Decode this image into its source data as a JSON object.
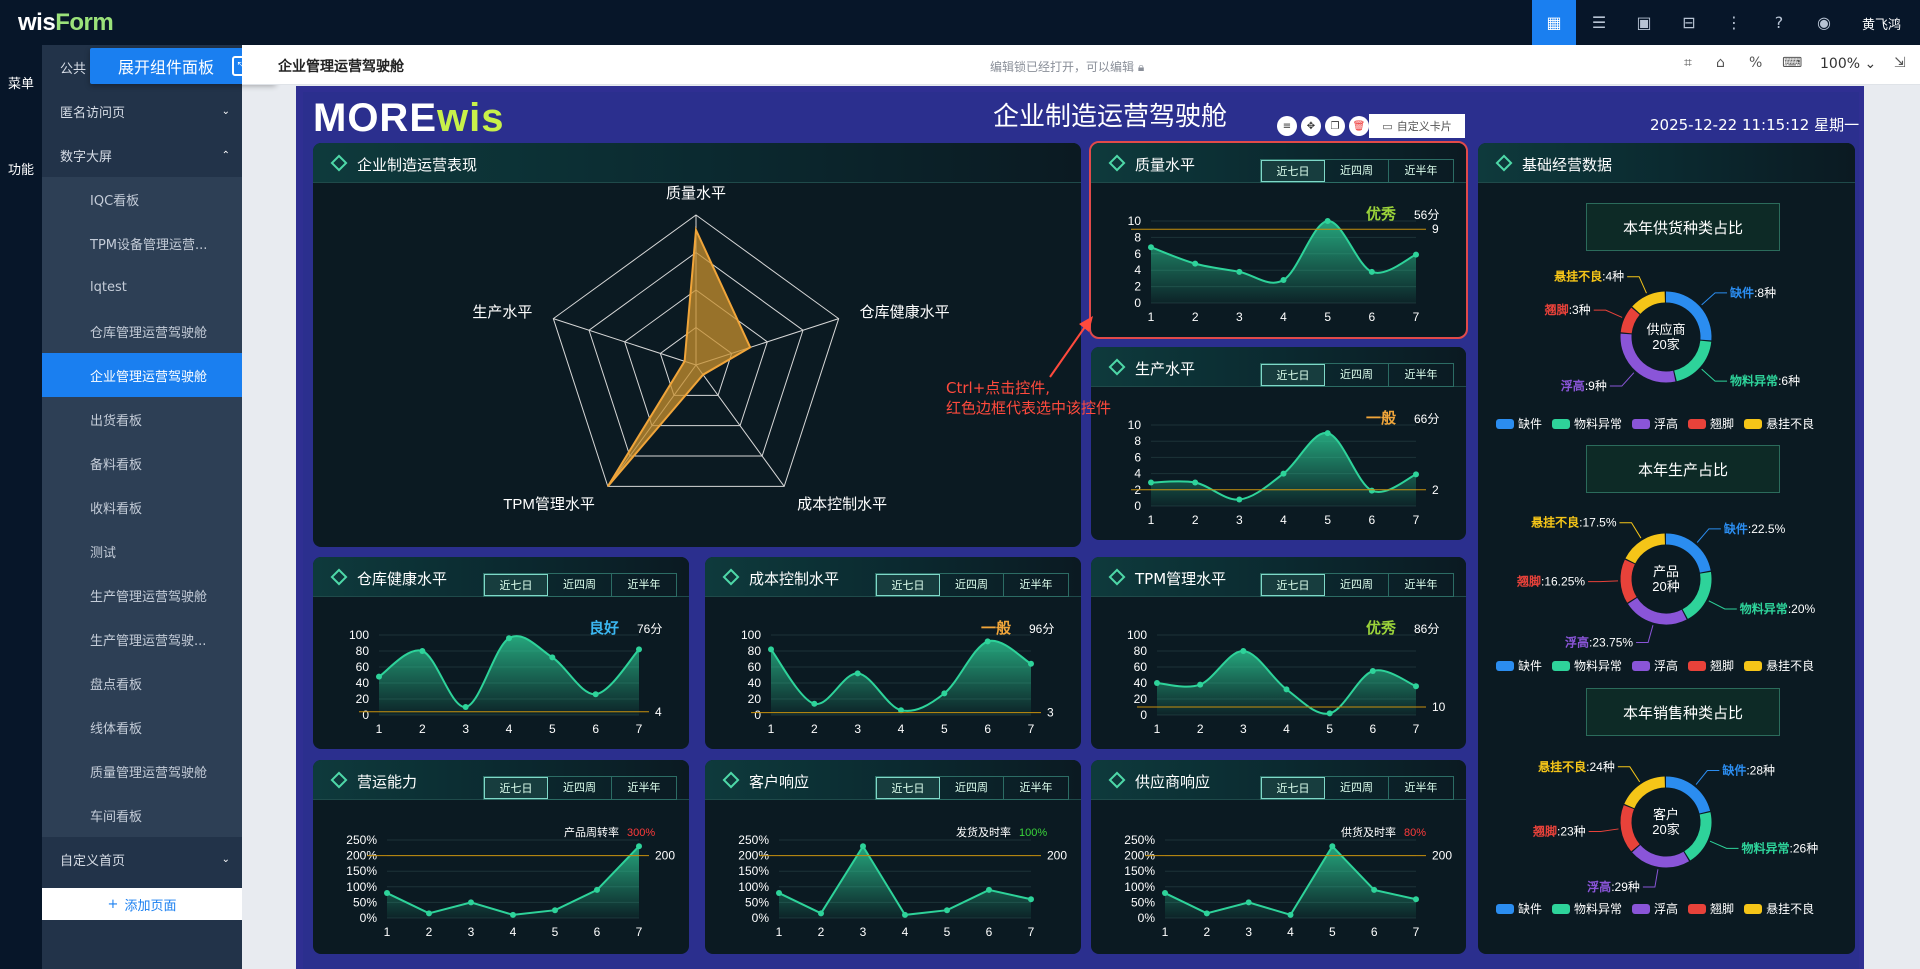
{
  "app": {
    "logo_main": "wis",
    "logo_accent": "Form",
    "username": "黄飞鸿"
  },
  "rail": {
    "menu": "菜单",
    "func": "功能"
  },
  "sidebar": {
    "public_partial": "公共",
    "items": [
      {
        "label": "匿名访问页",
        "type": "group",
        "chev": "⌄"
      },
      {
        "label": "数字大屏",
        "type": "group",
        "chev": "⌃"
      },
      {
        "label": "IQC看板",
        "type": "sub"
      },
      {
        "label": "TPM设备管理运营...",
        "type": "sub"
      },
      {
        "label": "lqtest",
        "type": "sub"
      },
      {
        "label": "仓库管理运营驾驶舱",
        "type": "sub"
      },
      {
        "label": "企业管理运营驾驶舱",
        "type": "sub",
        "active": true
      },
      {
        "label": "出货看板",
        "type": "sub"
      },
      {
        "label": "备料看板",
        "type": "sub"
      },
      {
        "label": "收料看板",
        "type": "sub"
      },
      {
        "label": "测试",
        "type": "sub"
      },
      {
        "label": "生产管理运营驾驶舱",
        "type": "sub"
      },
      {
        "label": "生产管理运营驾驶...",
        "type": "sub"
      },
      {
        "label": "盘点看板",
        "type": "sub"
      },
      {
        "label": "线体看板",
        "type": "sub"
      },
      {
        "label": "质量管理运营驾驶舱",
        "type": "sub"
      },
      {
        "label": "车间看板",
        "type": "sub"
      },
      {
        "label": "自定义首页",
        "type": "group",
        "chev": "⌄"
      }
    ],
    "add_page": "添加页面"
  },
  "expand_button": "展开组件面板",
  "subbar": {
    "page_name": "企业管理运营驾驶舱",
    "lock_note": "编辑锁已经打开，可以编辑",
    "zoom": "100%"
  },
  "dashboard": {
    "brand_a": "MORE",
    "brand_b": "wis",
    "title": "企业制造运营驾驶舱",
    "datetime": "2025-12-22 11:15:12 星期一",
    "custom_card": "自定义卡片",
    "hint": [
      "Ctrl+点击控件,",
      "红色边框代表选中该控件"
    ],
    "tabs": [
      "近七日",
      "近四周",
      "近半年"
    ],
    "panels": {
      "radar": {
        "title": "企业制造运营表现"
      },
      "quality": {
        "title": "质量水平",
        "grade": "优秀",
        "score": "56分"
      },
      "production": {
        "title": "生产水平",
        "grade": "一般",
        "score": "66分"
      },
      "warehouse": {
        "title": "仓库健康水平",
        "grade": "良好",
        "score": "76分"
      },
      "cost": {
        "title": "成本控制水平",
        "grade": "一般",
        "score": "96分"
      },
      "tpm": {
        "title": "TPM管理水平",
        "grade": "优秀",
        "score": "86分"
      },
      "ops": {
        "title": "营运能力",
        "metric": "产品周转率",
        "pct": "300%"
      },
      "customer": {
        "title": "客户响应",
        "metric": "发货及时率",
        "pct": "100%"
      },
      "supplier": {
        "title": "供应商响应",
        "metric": "供货及时率",
        "pct": "80%"
      },
      "basic": {
        "title": "基础经营数据"
      }
    },
    "donut_legend": [
      "缺件",
      "物料异常",
      "浮高",
      "翘脚",
      "悬挂不良"
    ],
    "donuts": [
      {
        "subtitle": "本年供货种类占比",
        "center": [
          "供应商",
          "20家"
        ],
        "labels": [
          {
            "name": "缺件",
            "val": ":8种"
          },
          {
            "name": "物料异常",
            "val": ":6种"
          },
          {
            "name": "浮高",
            "val": ":9种"
          },
          {
            "name": "翘脚",
            "val": ":3种"
          },
          {
            "name": "悬挂不良",
            "val": ":4种"
          }
        ]
      },
      {
        "subtitle": "本年生产占比",
        "center": [
          "产品",
          "20种"
        ],
        "labels": [
          {
            "name": "缺件",
            "val": ":22.5%"
          },
          {
            "name": "物料异常",
            "val": ":20%"
          },
          {
            "name": "浮高",
            "val": ":23.75%"
          },
          {
            "name": "翘脚",
            "val": ":16.25%"
          },
          {
            "name": "悬挂不良",
            "val": ":17.5%"
          }
        ]
      },
      {
        "subtitle": "本年销售种类占比",
        "center": [
          "客户",
          "20家"
        ],
        "labels": [
          {
            "name": "缺件",
            "val": ":28种"
          },
          {
            "name": "物料异常",
            "val": ":26种"
          },
          {
            "name": "浮高",
            "val": ":29种"
          },
          {
            "name": "翘脚",
            "val": ":23种"
          },
          {
            "name": "悬挂不良",
            "val": ":24种"
          }
        ]
      }
    ],
    "colors": {
      "accent": "#1a7ff0",
      "green": "#2ed39a",
      "gold": "#f0a53a",
      "blue": "#2b8df0",
      "purple": "#8a55d8",
      "red": "#e8423a",
      "yellow": "#f5c518",
      "ok_green": "#9bd33a",
      "warn_orange": "#f0a53a",
      "good_blue": "#3bb6f0"
    }
  },
  "chart_data": [
    {
      "type": "radar",
      "indicators": [
        "质量水平",
        "仓库健康水平",
        "成本控制水平",
        "TPM管理水平",
        "生产水平"
      ],
      "values": [
        0.9,
        0.38,
        0.08,
        1.0,
        0.08
      ],
      "max": 1
    },
    {
      "type": "area",
      "name": "质量水平",
      "x": [
        1,
        2,
        3,
        4,
        5,
        6,
        7
      ],
      "values": [
        6.8,
        4.8,
        3.8,
        2.8,
        10,
        3.8,
        5.9
      ],
      "ylim": [
        0,
        10
      ],
      "yticks": [
        0,
        2,
        4,
        6,
        8,
        10
      ],
      "threshold": 9
    },
    {
      "type": "area",
      "name": "生产水平",
      "x": [
        1,
        2,
        3,
        4,
        5,
        6,
        7
      ],
      "values": [
        2.9,
        2.9,
        0.8,
        4,
        9,
        1.9,
        3.9
      ],
      "ylim": [
        0,
        10
      ],
      "yticks": [
        0,
        2,
        4,
        6,
        8,
        10
      ],
      "threshold": 2
    },
    {
      "type": "area",
      "name": "仓库健康水平",
      "x": [
        1,
        2,
        3,
        4,
        5,
        6,
        7
      ],
      "values": [
        48,
        80,
        10,
        96,
        72,
        26,
        82
      ],
      "ylim": [
        0,
        100
      ],
      "yticks": [
        0,
        20,
        40,
        60,
        80,
        100
      ],
      "threshold": 4
    },
    {
      "type": "area",
      "name": "成本控制水平",
      "x": [
        1,
        2,
        3,
        4,
        5,
        6,
        7
      ],
      "values": [
        82,
        14,
        52,
        6,
        27,
        92,
        64
      ],
      "ylim": [
        0,
        100
      ],
      "yticks": [
        0,
        20,
        40,
        60,
        80,
        100
      ],
      "threshold": 3
    },
    {
      "type": "area",
      "name": "TPM管理水平",
      "x": [
        1,
        2,
        3,
        4,
        5,
        6,
        7
      ],
      "values": [
        40,
        38,
        80,
        32,
        2,
        55,
        36
      ],
      "ylim": [
        0,
        100
      ],
      "yticks": [
        0,
        20,
        40,
        60,
        80,
        100
      ],
      "threshold": 10
    },
    {
      "type": "area",
      "name": "营运能力",
      "x": [
        1,
        2,
        3,
        4,
        5,
        6,
        7
      ],
      "values": [
        80,
        15,
        50,
        10,
        25,
        90,
        230
      ],
      "ylim": [
        0,
        250
      ],
      "ytick_labels": [
        "0%",
        "50%",
        "100%",
        "150%",
        "200%",
        "250%"
      ],
      "threshold": 200,
      "threshold_label": "200"
    },
    {
      "type": "area",
      "name": "客户响应",
      "x": [
        1,
        2,
        3,
        4,
        5,
        6,
        7
      ],
      "values": [
        80,
        15,
        230,
        10,
        25,
        90,
        60
      ],
      "ylim": [
        0,
        250
      ],
      "ytick_labels": [
        "0%",
        "50%",
        "100%",
        "150%",
        "200%",
        "250%"
      ],
      "threshold": 200,
      "threshold_label": "200"
    },
    {
      "type": "area",
      "name": "供应商响应",
      "x": [
        1,
        2,
        3,
        4,
        5,
        6,
        7
      ],
      "values": [
        80,
        15,
        50,
        10,
        230,
        90,
        60
      ],
      "ylim": [
        0,
        250
      ],
      "ytick_labels": [
        "0%",
        "50%",
        "100%",
        "150%",
        "200%",
        "250%"
      ],
      "threshold": 200,
      "threshold_label": "200"
    },
    {
      "type": "pie",
      "name": "本年供货种类占比",
      "categories": [
        "缺件",
        "物料异常",
        "浮高",
        "翘脚",
        "悬挂不良"
      ],
      "values": [
        8,
        6,
        9,
        3,
        4
      ]
    },
    {
      "type": "pie",
      "name": "本年生产占比",
      "categories": [
        "缺件",
        "物料异常",
        "浮高",
        "翘脚",
        "悬挂不良"
      ],
      "values": [
        22.5,
        20,
        23.75,
        16.25,
        17.5
      ]
    },
    {
      "type": "pie",
      "name": "本年销售种类占比",
      "categories": [
        "缺件",
        "物料异常",
        "浮高",
        "翘脚",
        "悬挂不良"
      ],
      "values": [
        28,
        26,
        29,
        23,
        24
      ]
    }
  ]
}
